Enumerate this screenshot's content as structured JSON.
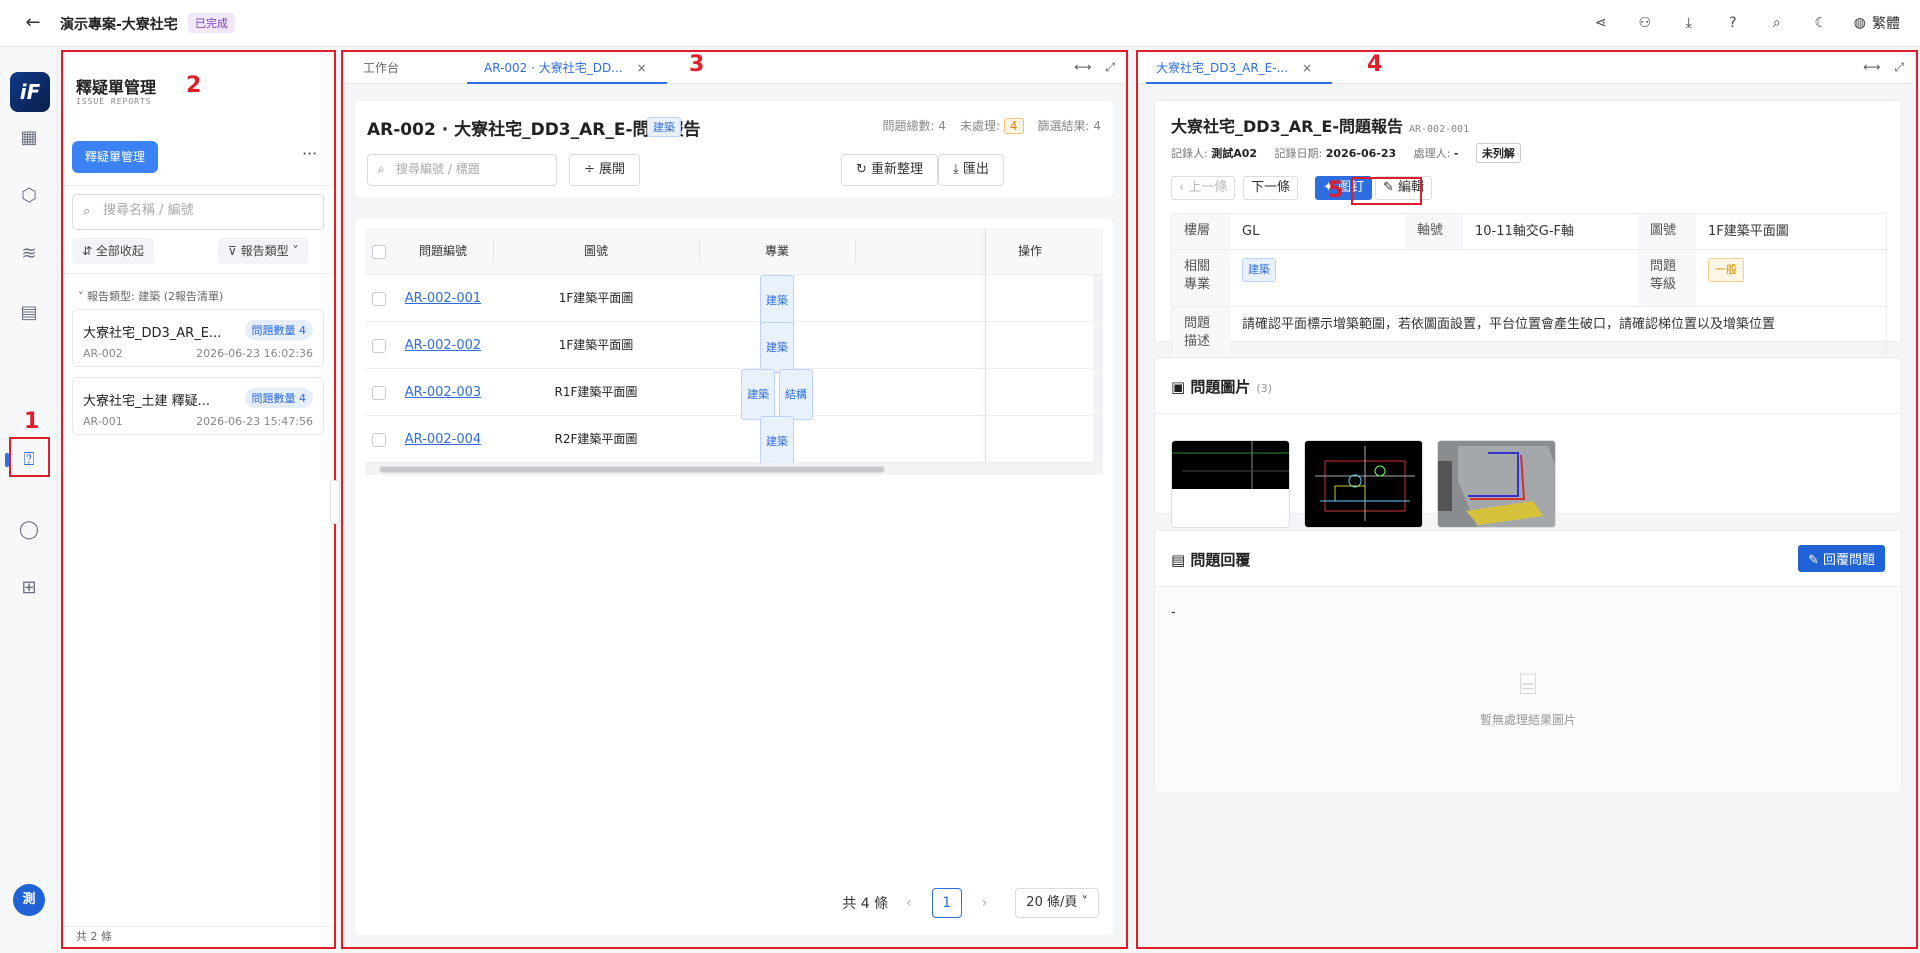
{
  "topbar": {
    "project_title": "演示專案-大寮社宅",
    "status_badge": "已完成",
    "language": "繁體"
  },
  "rail": {
    "logo_text": "iF",
    "avatar": "測"
  },
  "annotations": {
    "n1": "1",
    "n2": "2",
    "n3": "3",
    "n4": "4",
    "n5": "5"
  },
  "issue_panel": {
    "title": "釋疑單管理",
    "subtitle": "ISSUE REPORTS",
    "primary_button": "釋疑單管理",
    "more": "···",
    "search_placeholder": "搜尋名稱 / 編號",
    "collapse_all": "全部收起",
    "report_type": "報告類型",
    "group_label": "報告類型: 建築 (2報告清單)",
    "cards": [
      {
        "title": "大寮社宅_DD3_AR_E...",
        "badge": "問題數量 4",
        "id": "AR-002",
        "date": "2026-06-23 16:02:36"
      },
      {
        "title": "大寮社宅_土建 釋疑...",
        "badge": "問題數量 4",
        "id": "AR-001",
        "date": "2026-06-23 15:47:56"
      }
    ],
    "footer": "共 2 條"
  },
  "list_panel": {
    "tabs": [
      {
        "label": "工作台"
      },
      {
        "label": "AR-002 · 大寮社宅_DD...",
        "close": "×"
      }
    ],
    "report_title": "AR-002 · 大寮社宅_DD3_AR_E-問題報告",
    "discipline_tag": "建築",
    "stats": {
      "total_label": "問題總數: 4",
      "pending_label": "未處理:",
      "pending_value": "4",
      "filter_label": "篩選結果: 4"
    },
    "search_placeholder": "搜尋編號 / 標題",
    "expand": "展開",
    "refresh": "重新整理",
    "export": "匯出",
    "columns": [
      "問題編號",
      "圖號",
      "專業",
      "操作"
    ],
    "rows": [
      {
        "id": "AR-002-001",
        "drawing": "1F建築平面圖",
        "tags": [
          "建築"
        ]
      },
      {
        "id": "AR-002-002",
        "drawing": "1F建築平面圖",
        "tags": [
          "建築"
        ]
      },
      {
        "id": "AR-002-003",
        "drawing": "R1F建築平面圖",
        "tags": [
          "建築",
          "結構"
        ]
      },
      {
        "id": "AR-002-004",
        "drawing": "R2F建築平面圖",
        "tags": [
          "建築"
        ]
      }
    ],
    "pager": {
      "total": "共 4 條",
      "page": "1",
      "page_size": "20 條/頁"
    }
  },
  "detail_panel": {
    "tab": {
      "label": "大寮社宅_DD3_AR_E-...",
      "close": "×"
    },
    "title": "大寮社宅_DD3_AR_E-問題報告",
    "code": "AR-002-001",
    "meta": {
      "recorder_label": "記錄人:",
      "recorder": "測試A02",
      "date_label": "記錄日期:",
      "date": "2026-06-23",
      "handler_label": "處理人:",
      "handler": "-",
      "status": "未列解"
    },
    "buttons": {
      "prev": "上一條",
      "next": "下一條",
      "pin": "图钉",
      "edit": "編輯"
    },
    "fields": {
      "floor_label": "樓層",
      "floor": "GL",
      "axis_label": "軸號",
      "axis": "10-11軸交G-F軸",
      "drawing_label": "圖號",
      "drawing": "1F建築平面圖",
      "discipline_label": "相關\n專業",
      "discipline": "建築",
      "level_label": "問題\n等級",
      "level": "一般",
      "desc_label": "問題\n描述",
      "desc": "請確認平面標示增築範圍，若依圖面設置，平台位置會產生破口，請確認梯位置以及增築位置"
    },
    "images": {
      "title": "問題圖片",
      "count": "(3)"
    },
    "reply": {
      "title": "問題回覆",
      "button": "回覆問題",
      "content": "-",
      "empty": "暫無處理結果圖片"
    }
  }
}
